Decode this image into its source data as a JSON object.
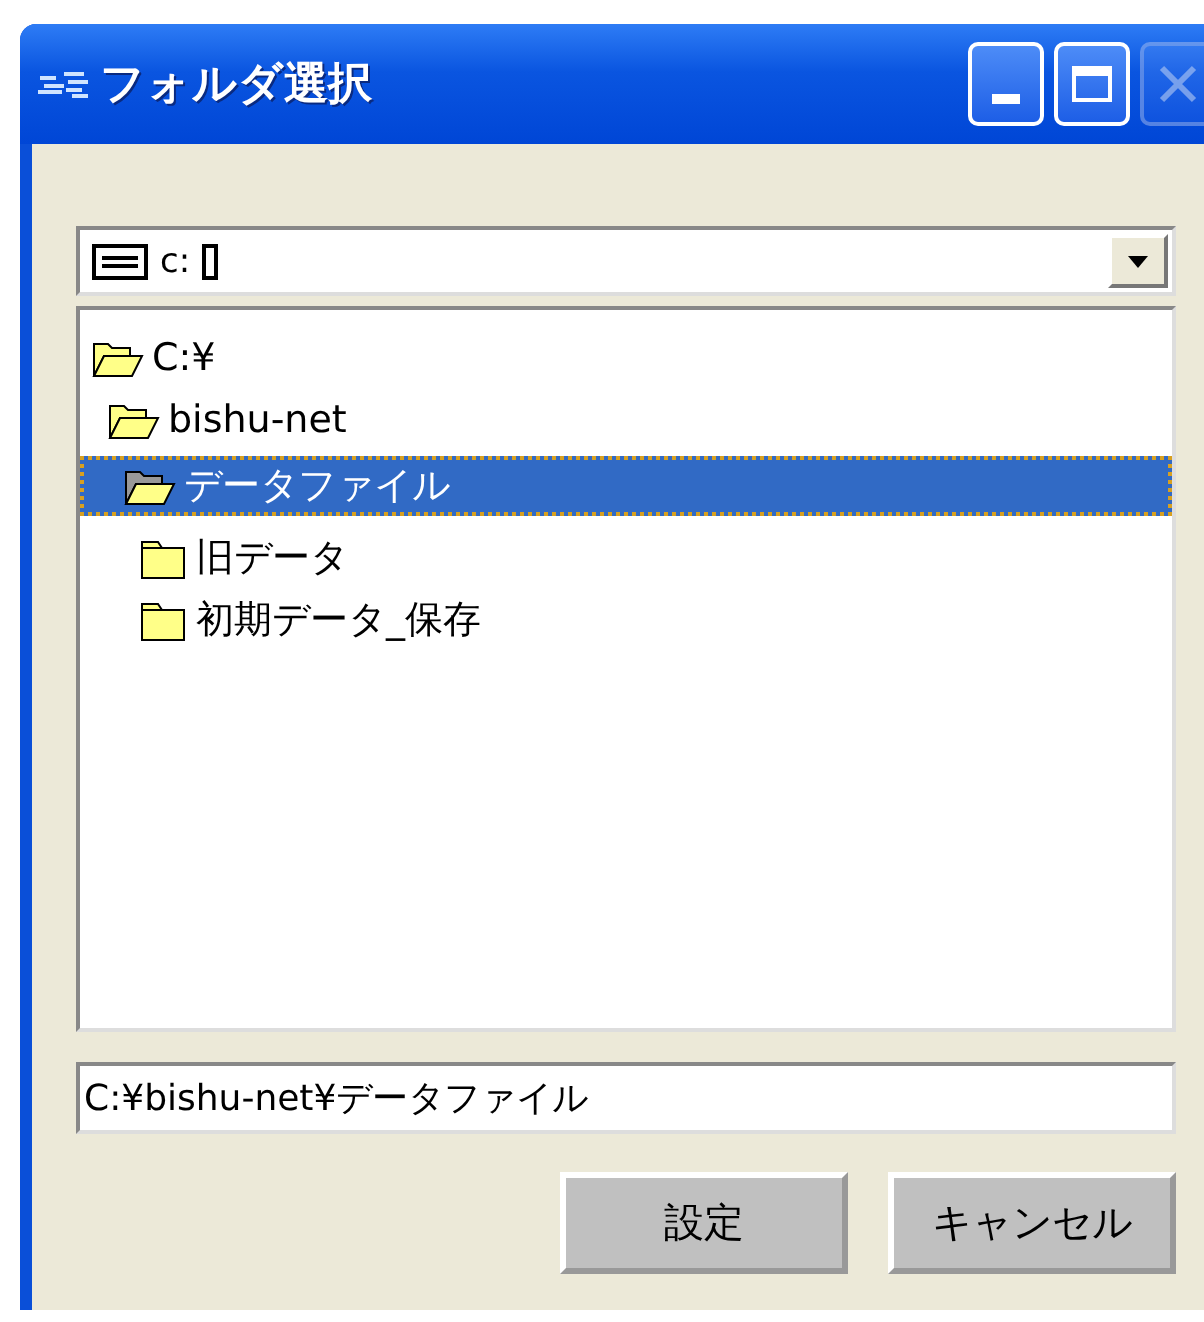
{
  "window": {
    "title": "フォルダ選択",
    "close_disabled": true
  },
  "drive": {
    "value": "c:"
  },
  "tree": [
    {
      "label": "C:¥",
      "expanded": true,
      "selected": false,
      "children": [
        {
          "label": "bishu-net",
          "expanded": true,
          "selected": false,
          "children": [
            {
              "label": "データファイル",
              "expanded": true,
              "selected": true,
              "children": [
                {
                  "label": "旧データ",
                  "expanded": false,
                  "selected": false
                },
                {
                  "label": "初期データ_保存",
                  "expanded": false,
                  "selected": false
                }
              ]
            }
          ]
        }
      ]
    }
  ],
  "path": {
    "value": "C:¥bishu-net¥データファイル"
  },
  "buttons": [
    "設定",
    "キャンセル"
  ]
}
